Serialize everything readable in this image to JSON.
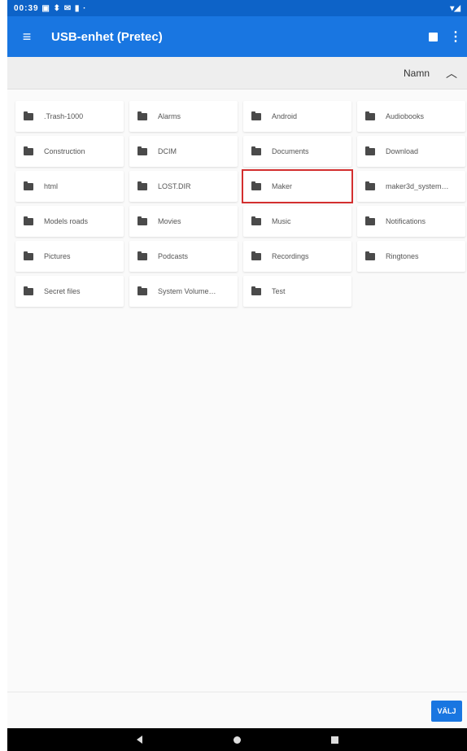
{
  "status_bar": {
    "left": "00:39 ▣ ⬍ ✉ ▮ ·",
    "right": "▾◢"
  },
  "app_bar": {
    "title": "USB-enhet (Pretec)",
    "menu_icon": "hamburger-menu-icon",
    "view_icon": "grid-view-icon",
    "more_icon": "more-vert-icon"
  },
  "sort_bar": {
    "label": "Namn",
    "direction_icon": "chevron-up-icon"
  },
  "folders": [
    {
      "label": ".Trash-1000"
    },
    {
      "label": "Alarms"
    },
    {
      "label": "Android"
    },
    {
      "label": "Audiobooks"
    },
    {
      "label": "Construction"
    },
    {
      "label": "DCIM"
    },
    {
      "label": "Documents"
    },
    {
      "label": "Download"
    },
    {
      "label": "html"
    },
    {
      "label": "LOST.DIR"
    },
    {
      "label": "Maker",
      "selected": true
    },
    {
      "label": "maker3d_system…"
    },
    {
      "label": "Models roads"
    },
    {
      "label": "Movies"
    },
    {
      "label": "Music"
    },
    {
      "label": "Notifications"
    },
    {
      "label": "Pictures"
    },
    {
      "label": "Podcasts"
    },
    {
      "label": "Recordings"
    },
    {
      "label": "Ringtones"
    },
    {
      "label": "Secret files"
    },
    {
      "label": "System Volume…"
    },
    {
      "label": "Test"
    }
  ],
  "actions": {
    "select_label": "VÄLJ"
  },
  "colors": {
    "primary": "#1976e1",
    "status_bar": "#0d63c8",
    "highlight": "#d32f2f"
  }
}
